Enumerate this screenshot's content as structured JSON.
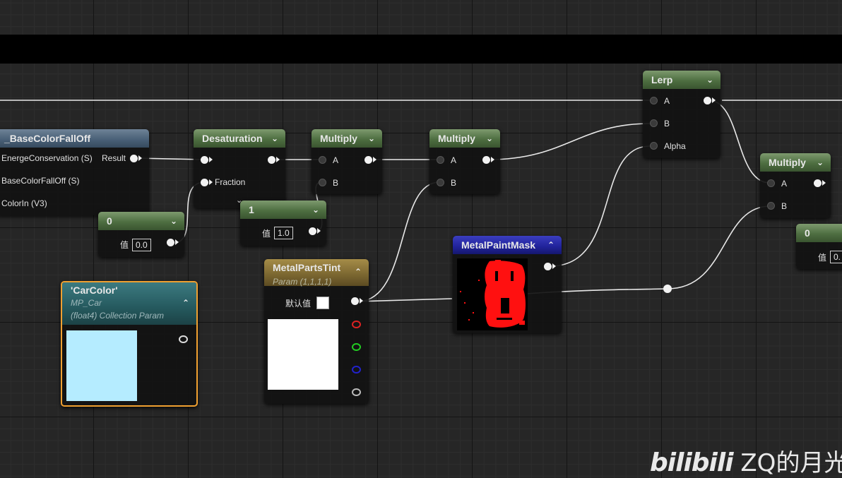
{
  "nodes": {
    "basecolor": {
      "title": "_BaseColorFallOff",
      "pins": [
        "EnergeConservation (S)",
        "BaseColorFallOff (S)",
        "ColorIn (V3)"
      ],
      "out": "Result"
    },
    "desat": {
      "title": "Desaturation",
      "pin_fraction": "Fraction"
    },
    "mul1": {
      "title": "Multiply",
      "a": "A",
      "b": "B"
    },
    "mul2": {
      "title": "Multiply",
      "a": "A",
      "b": "B"
    },
    "mul3": {
      "title": "Multiply",
      "a": "A",
      "b": "B"
    },
    "lerp": {
      "title": "Lerp",
      "a": "A",
      "b": "B",
      "alpha": "Alpha"
    },
    "const0": {
      "title": "0",
      "label": "值",
      "value": "0.0"
    },
    "const1": {
      "title": "1",
      "label": "值",
      "value": "1.0"
    },
    "const0b": {
      "title": "0",
      "label": "值",
      "value": "0."
    },
    "mask": {
      "title": "MetalPaintMask"
    },
    "tint": {
      "title": "MetalPartsTint",
      "subtitle": "Param (1,1,1,1)",
      "default_label": "默认值",
      "swatch_color": "#ffffff"
    },
    "carcolor": {
      "title": "'CarColor'",
      "sub1": "MP_Car",
      "sub2": "(float4) Collection Param",
      "swatch_color": "#b5ecff"
    }
  },
  "watermark": {
    "logo": "bilibili",
    "text": "ZQ的月光"
  },
  "colors": {
    "selection": "#f0a030",
    "wire": "#e8e8e8"
  }
}
